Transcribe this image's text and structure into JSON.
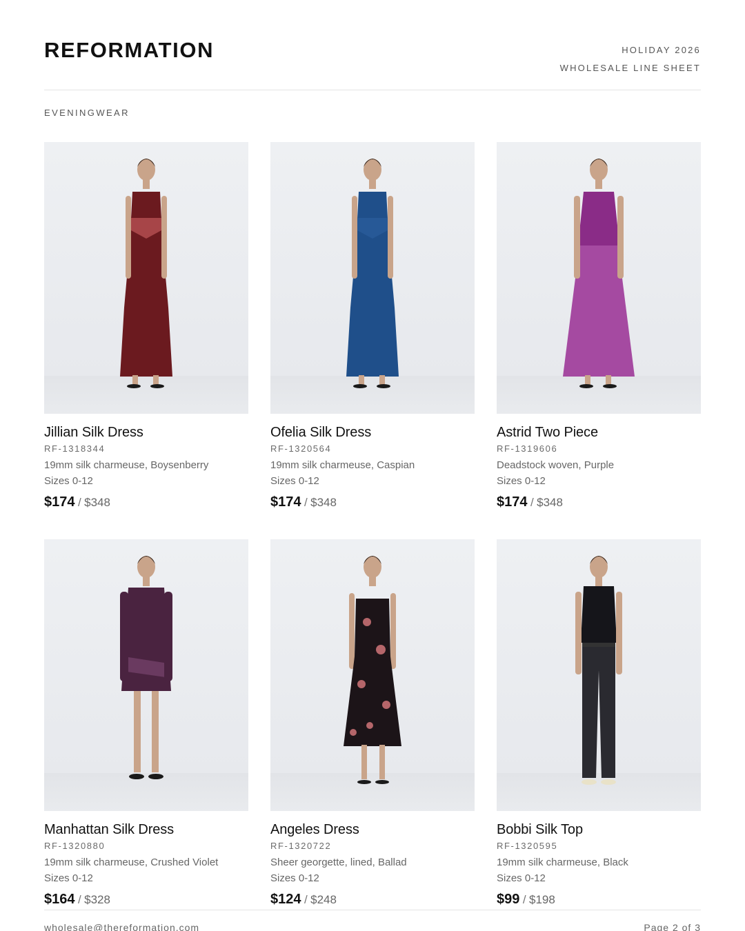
{
  "header": {
    "brand": "REFORMATION",
    "season": "HOLIDAY 2026",
    "doc_type": "WHOLESALE LINE SHEET"
  },
  "section": {
    "title": "EVENINGWEAR"
  },
  "products": [
    {
      "name": "Jillian Silk Dress",
      "sku": "RF-1318344",
      "fabric": "19mm silk charmeuse, Boysenberry",
      "sizes": "Sizes 0-12",
      "wholesale": "$174",
      "separator": "/",
      "retail": "$348",
      "garment_color": "#6b1a1f",
      "accent_color": "#d96a6a",
      "image": "model-in-long-slip-dress"
    },
    {
      "name": "Ofelia Silk Dress",
      "sku": "RF-1320564",
      "fabric": "19mm silk charmeuse, Caspian",
      "sizes": "Sizes 0-12",
      "wholesale": "$174",
      "separator": "/",
      "retail": "$348",
      "garment_color": "#1f4f8a",
      "accent_color": "#2e63a3",
      "image": "model-in-long-slip-dress"
    },
    {
      "name": "Astrid Two Piece",
      "sku": "RF-1319606",
      "fabric": "Deadstock woven, Purple",
      "sizes": "Sizes 0-12",
      "wholesale": "$174",
      "separator": "/",
      "retail": "$348",
      "garment_color": "#8a2c87",
      "accent_color": "#a54aa1",
      "image": "model-in-two-piece"
    },
    {
      "name": "Manhattan Silk Dress",
      "sku": "RF-1320880",
      "fabric": "19mm silk charmeuse, Crushed Violet",
      "sizes": "Sizes 0-12",
      "wholesale": "$164",
      "separator": "/",
      "retail": "$328",
      "garment_color": "#4a2340",
      "accent_color": "#6a3a60",
      "image": "model-in-wrap-mini-dress"
    },
    {
      "name": "Angeles Dress",
      "sku": "RF-1320722",
      "fabric": "Sheer georgette, lined, Ballad",
      "sizes": "Sizes 0-12",
      "wholesale": "$124",
      "separator": "/",
      "retail": "$248",
      "garment_color": "#1c1418",
      "accent_color": "#b5666a",
      "image": "model-in-floral-strapless-dress"
    },
    {
      "name": "Bobbi Silk Top",
      "sku": "RF-1320595",
      "fabric": "19mm silk charmeuse, Black",
      "sizes": "Sizes 0-12",
      "wholesale": "$99",
      "separator": "/",
      "retail": "$198",
      "garment_color": "#15151a",
      "accent_color": "#2a2a30",
      "image": "model-in-black-top-and-trousers"
    }
  ],
  "footer": {
    "email": "wholesale@thereformation.com",
    "page": "Page 2 of 3"
  }
}
